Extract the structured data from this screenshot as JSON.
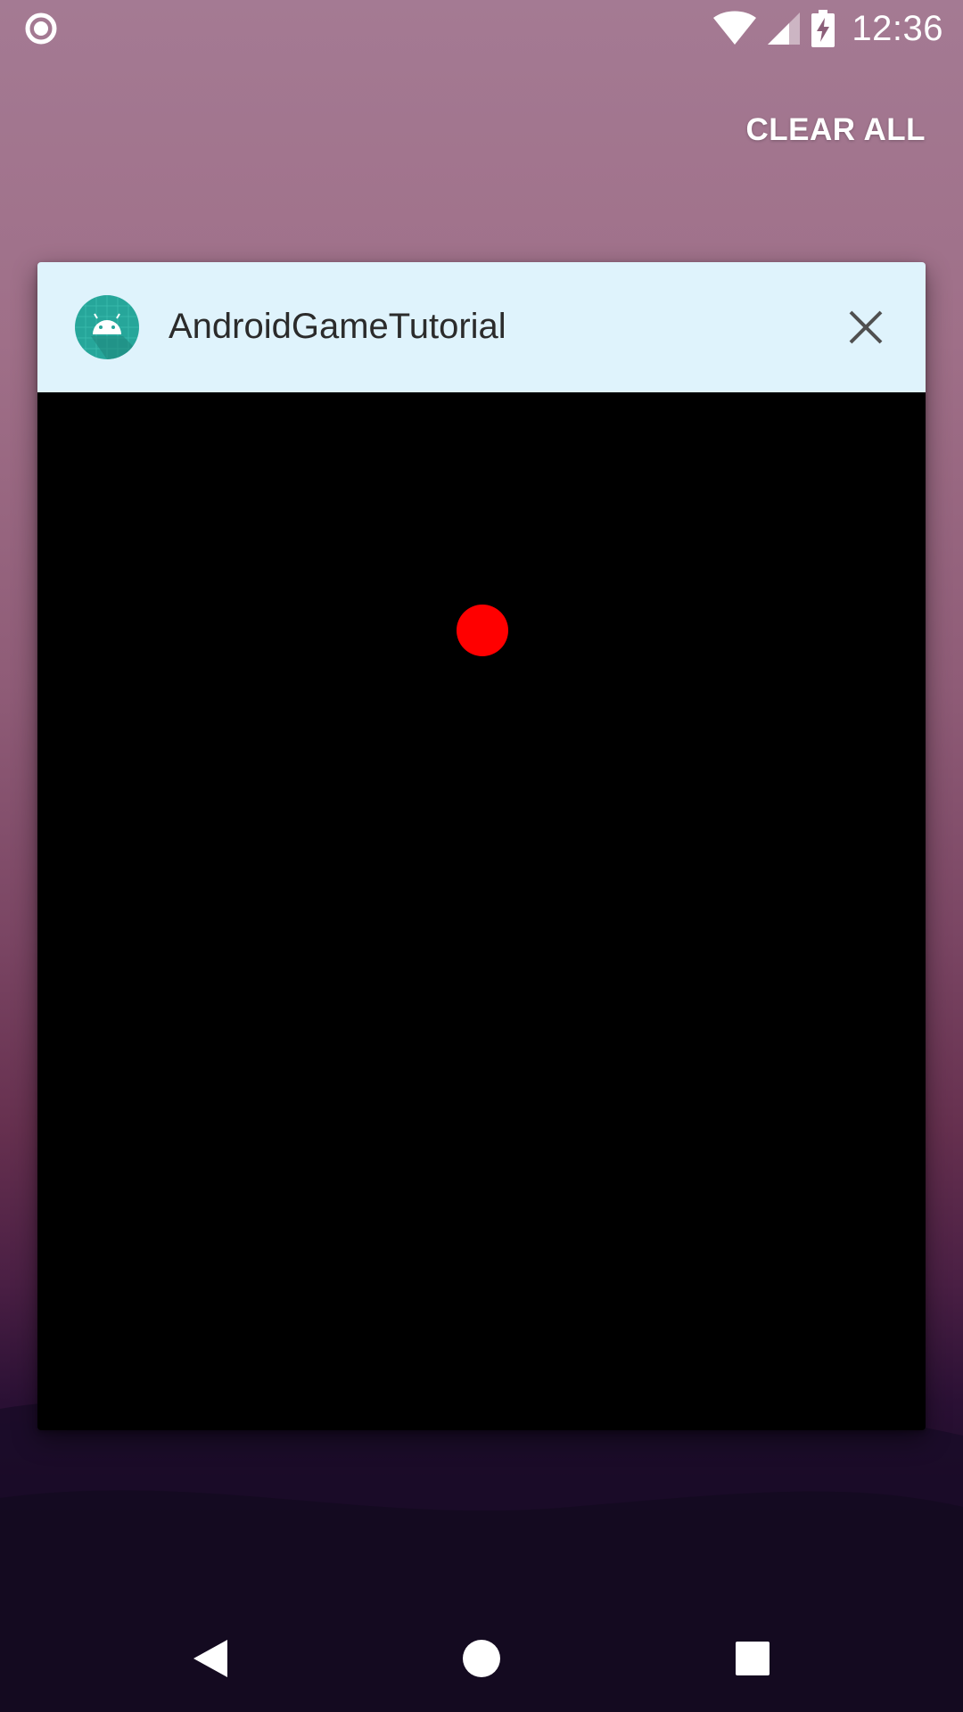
{
  "status_bar": {
    "time": "12:36",
    "left_icon": "record-circle-icon",
    "wifi_icon": "wifi-icon",
    "signal_icon": "cell-signal-icon",
    "battery_icon": "battery-charging-icon"
  },
  "recents": {
    "clear_all_label": "CLEAR ALL"
  },
  "task_card": {
    "app_name": "AndroidGameTutorial",
    "app_icon": "android-app-icon",
    "close_icon": "close-icon",
    "header_color": "#dff3fc",
    "preview_background": "#000000",
    "ball_color": "#ff0000"
  },
  "nav_bar": {
    "back_icon": "back-triangle-icon",
    "home_icon": "home-circle-icon",
    "recents_icon": "recents-square-icon"
  }
}
